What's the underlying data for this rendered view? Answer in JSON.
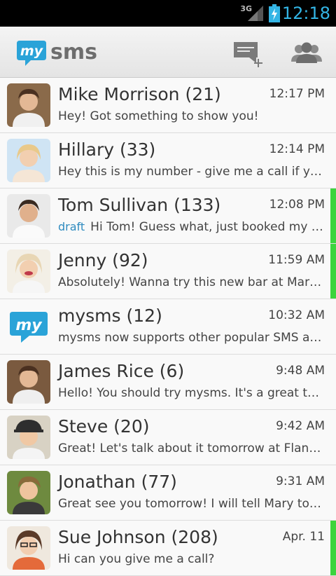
{
  "status": {
    "network": "3G",
    "time": "12:18"
  },
  "app": {
    "logo_my": "my",
    "logo_sms": "sms",
    "new_message_icon": "new-message-icon",
    "contacts_icon": "contacts-icon"
  },
  "conversations": [
    {
      "name": "Mike Morrison (21)",
      "time": "12:17 PM",
      "preview": "Hey! Got something to show you!",
      "draft": "",
      "unread": false,
      "avatar_color": "#8a6a4a"
    },
    {
      "name": "Hillary (33)",
      "time": "12:14 PM",
      "preview": "Hey this is my number - give me a call if you have time",
      "draft": "",
      "unread": false,
      "avatar_color": "#e9c98a"
    },
    {
      "name": "Tom Sullivan (133)",
      "time": "12:08 PM",
      "preview": "Hi Tom! Guess what, just booked my flight",
      "draft": "draft",
      "unread": true,
      "avatar_color": "#5c4636"
    },
    {
      "name": "Jenny (92)",
      "time": "11:59 AM",
      "preview": "Absolutely! Wanna try this new bar at Market Street?",
      "draft": "",
      "unread": true,
      "avatar_color": "#e8d6b4"
    },
    {
      "name": "mysms (12)",
      "time": "10:32 AM",
      "preview": "mysms now supports other popular SMS apps",
      "draft": "",
      "unread": false,
      "avatar_color": "#2aa3d8"
    },
    {
      "name": "James Rice (6)",
      "time": "9:48 AM",
      "preview": "Hello! You should try mysms. It's a great tool",
      "draft": "",
      "unread": false,
      "avatar_color": "#7a5a3f"
    },
    {
      "name": "Steve (20)",
      "time": "9:42 AM",
      "preview": "Great! Let's talk about it tomorrow at Flanagan's",
      "draft": "",
      "unread": false,
      "avatar_color": "#c9a77e"
    },
    {
      "name": "Jonathan (77)",
      "time": "9:31 AM",
      "preview": "Great see you tomorrow! I will tell Mary to come",
      "draft": "",
      "unread": false,
      "avatar_color": "#6e8a3f"
    },
    {
      "name": "Sue Johnson (208)",
      "time": "Apr. 11",
      "preview": "Hi can you give me a call?",
      "draft": "",
      "unread": true,
      "avatar_color": "#6b4a35"
    }
  ]
}
